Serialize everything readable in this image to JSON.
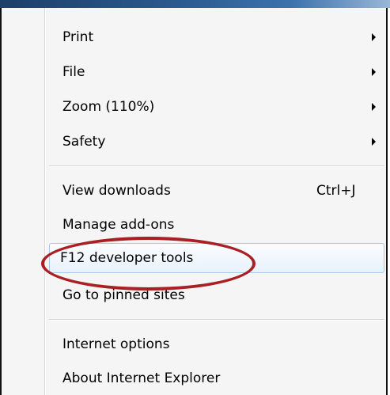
{
  "menu": {
    "items": [
      {
        "label": "Print",
        "submenu": true
      },
      {
        "label": "File",
        "submenu": true
      },
      {
        "label": "Zoom (110%)",
        "submenu": true
      },
      {
        "label": "Safety",
        "submenu": true
      },
      {
        "label": "View downloads",
        "shortcut": "Ctrl+J"
      },
      {
        "label": "Manage add-ons"
      },
      {
        "label": "F12 developer tools",
        "highlighted": true
      },
      {
        "label": "Go to pinned sites"
      },
      {
        "label": "Internet options"
      },
      {
        "label": "About Internet Explorer"
      }
    ]
  },
  "annotation": {
    "shape": "ellipse",
    "color": "#a82024",
    "target": "F12 developer tools"
  },
  "colors": {
    "title_bar": "#2a5a8f",
    "highlight_border": "#a8c8ea",
    "menu_bg": "#f5f5f5"
  }
}
